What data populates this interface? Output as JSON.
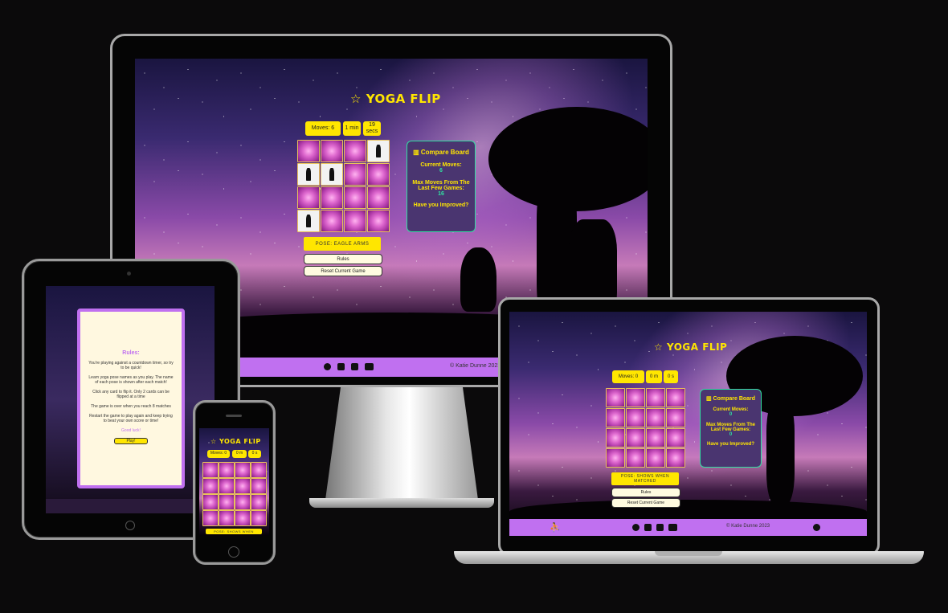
{
  "game": {
    "title": "YOGA FLIP",
    "star_icon": "star-icon"
  },
  "monitor": {
    "moves": "Moves: 6",
    "min": "1 min",
    "secs": "19 secs",
    "pose": "POSE: EAGLE ARMS",
    "rules_button": "Rules",
    "reset_button": "Reset Current Game",
    "board": {
      "title": "Compare Board",
      "current_moves_label": "Current Moves:",
      "current_moves_value": "6",
      "max_moves_label": "Max Moves From The Last Few Games:",
      "max_moves_value": "16",
      "improved": "Have you Improved?"
    },
    "copyright": "© Katie Dunne 2023"
  },
  "laptop": {
    "moves": "Moves: 0",
    "min": "0 m",
    "secs": "0 s",
    "pose": "POSE: SHOWS WHEN MATCHED",
    "rules_button": "Rules",
    "reset_button": "Reset Current Game",
    "board": {
      "title": "Compare Board",
      "current_moves_label": "Current Moves:",
      "current_moves_value": "0",
      "max_moves_label": "Max Moves From The Last Few Games:",
      "max_moves_value": "0",
      "improved": "Have you Improved?"
    },
    "copyright": "© Katie Dunne 2023"
  },
  "tablet": {
    "rules_title": "Rules:",
    "rules": [
      "You're playing against a countdown timer, so try to be quick!",
      "Learn yoga pose names as you play. The name of each pose is shown after each match!",
      "Click any card to flip it. Only 2 cards can be flipped at a time",
      "The game is over when you reach 8 matches",
      "Restart the game to play again and keep trying to beat your own score or time!"
    ],
    "good_luck": "Good luck!",
    "play_button": "Play!"
  },
  "phone": {
    "title": "YOGA FLIP",
    "moves": "Moves: 0",
    "min": "0 m",
    "secs": "0 s",
    "pose": "POSE: SHOWS WHEN"
  },
  "colors": {
    "accent": "#ffe600",
    "footer": "#c070f0",
    "board_bg": "#4a3570",
    "board_border": "#30e0a0"
  }
}
